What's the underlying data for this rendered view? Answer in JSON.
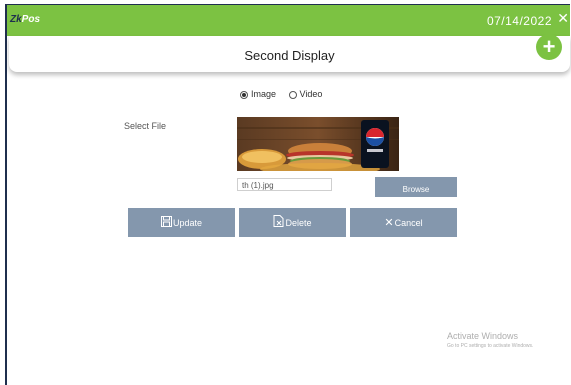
{
  "header": {
    "logo_prefix": "Zk",
    "logo_suffix": "Pos",
    "date": "07/14/2022",
    "close_icon": "close-icon",
    "accent_color": "#7cc242"
  },
  "page": {
    "title": "Second Display",
    "add_icon": "plus-icon"
  },
  "media_type": {
    "options": [
      "Image",
      "Video"
    ],
    "selected": "Image"
  },
  "file": {
    "label": "Select File",
    "filename": "th (1).jpg",
    "browse_label": "Browse",
    "preview_icon": "food-image-preview"
  },
  "actions": {
    "update_label": "Update",
    "delete_label": "Delete",
    "cancel_label": "Cancel",
    "button_color": "#8497ad"
  },
  "watermark": {
    "line1": "Activate Windows",
    "line2": "Go to PC settings to activate Windows."
  }
}
